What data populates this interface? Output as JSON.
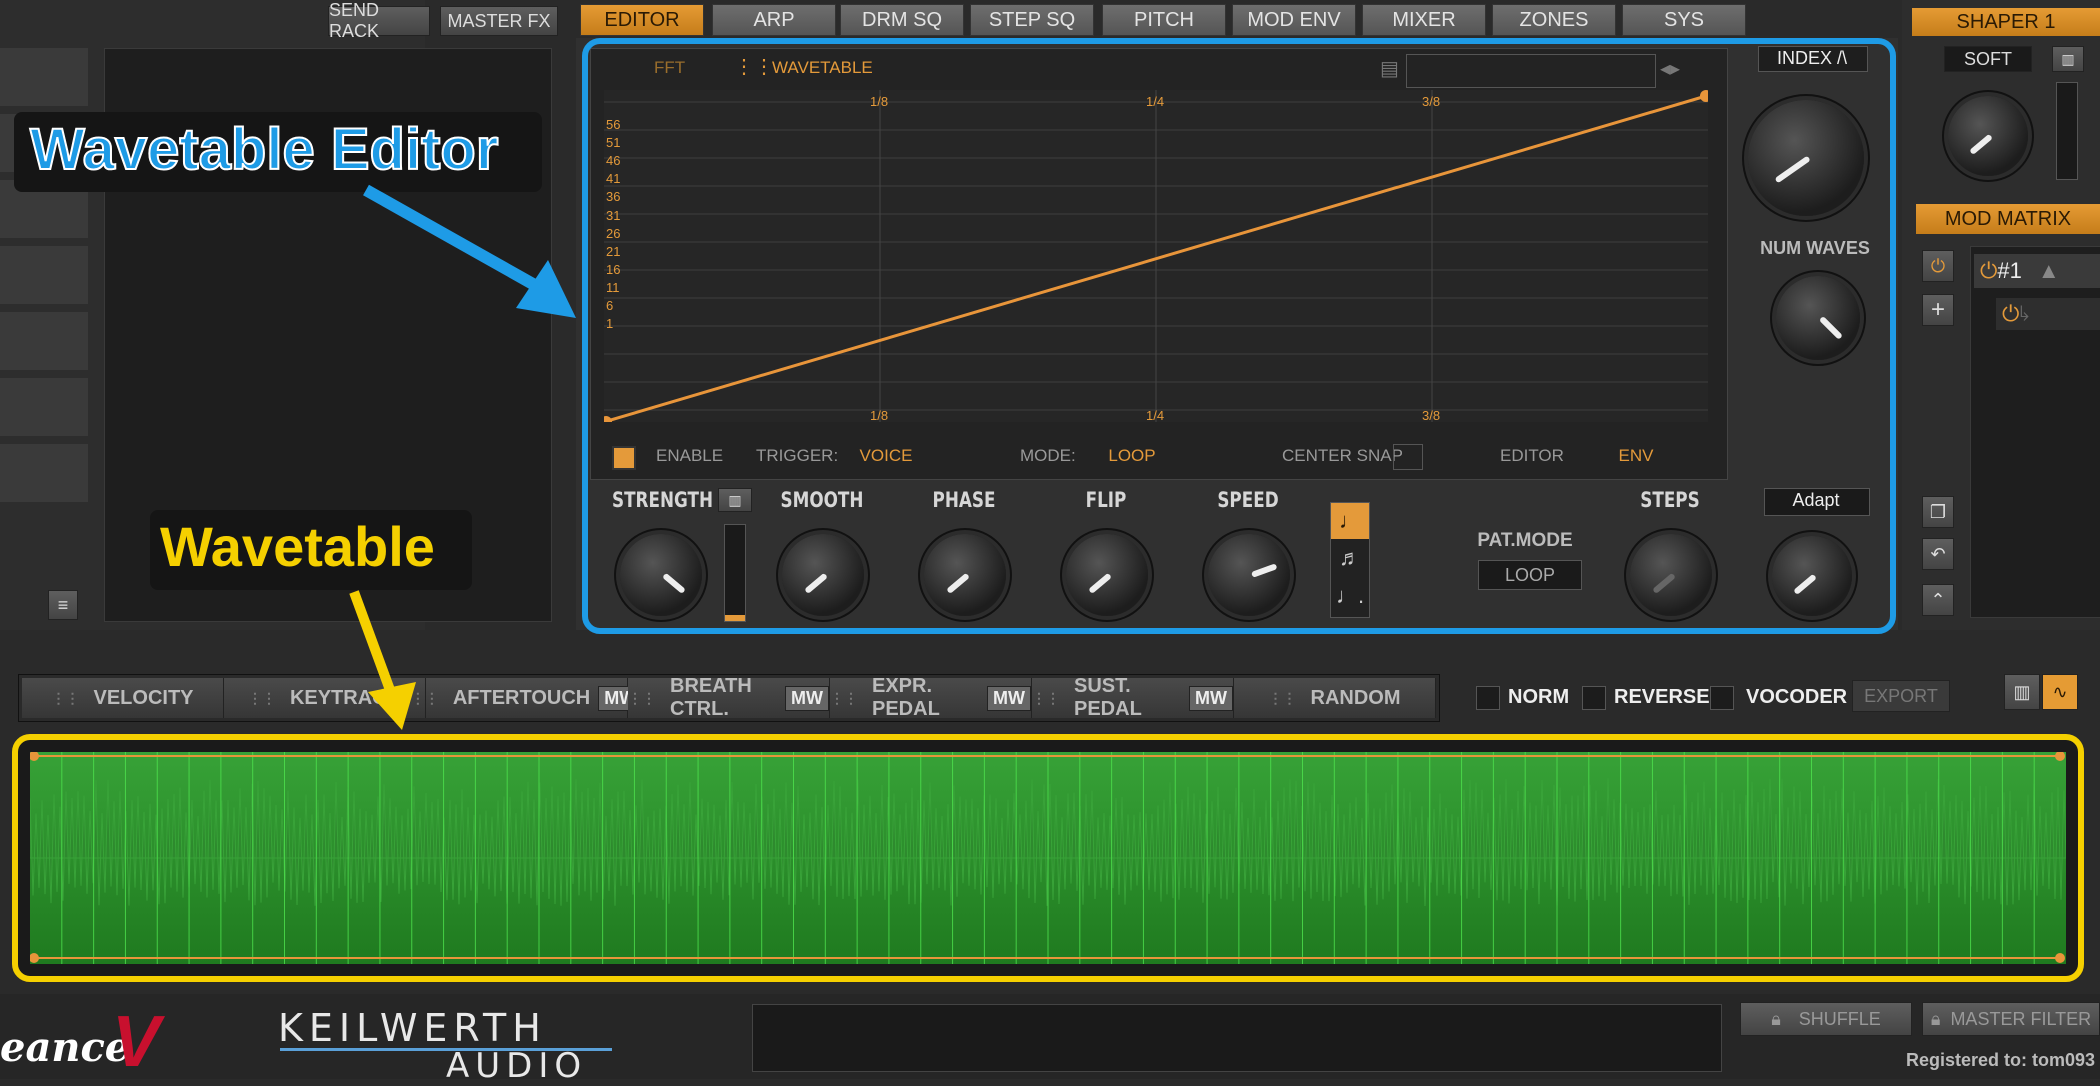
{
  "top_left": {
    "send_rack": "SEND RACK",
    "master_fx": "MASTER FX"
  },
  "tabs": [
    "EDITOR",
    "ARP",
    "DRM SQ",
    "STEP SQ",
    "PITCH",
    "MOD ENV",
    "MIXER",
    "ZONES",
    "SYS"
  ],
  "active_tab": "EDITOR",
  "editor": {
    "fft": "FFT",
    "wavetable": "WAVETABLE",
    "x_ticks": [
      "1/8",
      "1/4",
      "3/8"
    ],
    "y_ticks": [
      "56",
      "51",
      "46",
      "41",
      "36",
      "31",
      "26",
      "21",
      "16",
      "11",
      "6",
      "1"
    ],
    "enable_label": "ENABLE",
    "trigger_label": "TRIGGER:",
    "trigger_value": "VOICE",
    "mode_label": "MODE:",
    "mode_value": "LOOP",
    "center_snap_label": "CENTER SNAP",
    "editor_label": "EDITOR",
    "editor_value": "ENV"
  },
  "right_knobs": {
    "index_label": "INDEX /\\",
    "num_waves_label": "NUM WAVES",
    "adapt_label": "Adapt"
  },
  "bottom_knobs": {
    "strength": "STRENGTH",
    "smooth": "SMOOTH",
    "phase": "PHASE",
    "flip": "FLIP",
    "speed": "SPEED",
    "pat_mode_label": "PAT.MODE",
    "pat_mode_value": "LOOP",
    "steps": "STEPS"
  },
  "shaper": {
    "title": "SHAPER 1",
    "soft": "SOFT"
  },
  "mod_matrix": {
    "title": "MOD MATRIX",
    "slot": "#1"
  },
  "mod_sources": [
    {
      "label": "VELOCITY",
      "mw": ""
    },
    {
      "label": "KEYTRACK",
      "mw": ""
    },
    {
      "label": "AFTERTOUCH",
      "mw": "MW"
    },
    {
      "label": "BREATH CTRL.",
      "mw": "MW"
    },
    {
      "label": "EXPR. PEDAL",
      "mw": "MW"
    },
    {
      "label": "SUST. PEDAL",
      "mw": "MW"
    },
    {
      "label": "RANDOM",
      "mw": ""
    }
  ],
  "options": {
    "norm": "NORM",
    "reverse": "REVERSE",
    "vocoder": "VOCODER",
    "export": "EXPORT"
  },
  "footer": {
    "brand_left": "eance",
    "brand_main": "KEILWERTH",
    "brand_sub": "AUDIO",
    "shuffle": "SHUFFLE",
    "master_filter": "MASTER FILTER",
    "registered": "Registered to: tom093"
  },
  "annotations": {
    "wavetable_editor": "Wavetable Editor",
    "wavetable": "Wavetable"
  },
  "colors": {
    "accent": "#e59b34",
    "highlight_blue": "#1e9be6",
    "highlight_yellow": "#f5d000",
    "wave_green": "#2a9a2a"
  }
}
